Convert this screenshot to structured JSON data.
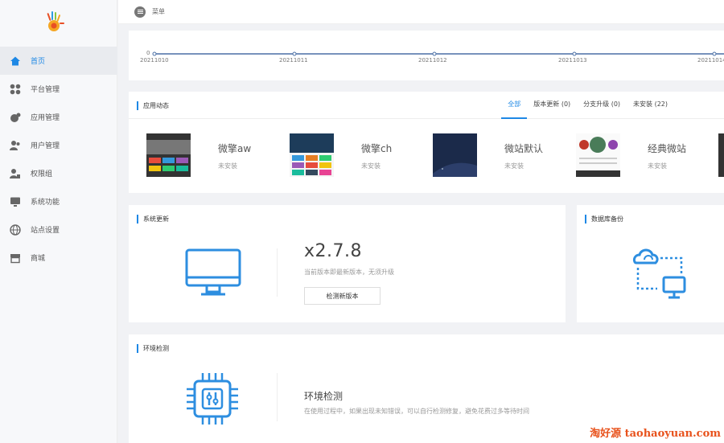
{
  "topbar": {
    "menu_label": "菜单"
  },
  "sidebar": {
    "items": [
      {
        "label": "首页",
        "icon": "home-icon",
        "active": true
      },
      {
        "label": "平台管理",
        "icon": "grid-icon"
      },
      {
        "label": "应用管理",
        "icon": "apps-icon"
      },
      {
        "label": "用户管理",
        "icon": "users-icon"
      },
      {
        "label": "权限组",
        "icon": "permission-icon"
      },
      {
        "label": "系统功能",
        "icon": "monitor-icon"
      },
      {
        "label": "站点设置",
        "icon": "globe-icon"
      },
      {
        "label": "商城",
        "icon": "store-icon"
      }
    ]
  },
  "timeline": {
    "zero": "0",
    "dates": [
      "20211010",
      "20211011",
      "20211012",
      "20211013",
      "20211014"
    ]
  },
  "apps": {
    "title": "应用动态",
    "tabs": [
      {
        "label": "全部",
        "active": true
      },
      {
        "label": "版本更新 (0)"
      },
      {
        "label": "分支升级 (0)"
      },
      {
        "label": "未安装 (22)"
      }
    ],
    "list": [
      {
        "name": "微擎aw",
        "status": "未安装"
      },
      {
        "name": "微擎ch",
        "status": "未安装"
      },
      {
        "name": "微站默认",
        "status": "未安装"
      },
      {
        "name": "经典微站",
        "status": "未安装"
      }
    ]
  },
  "update": {
    "title": "系统更新",
    "version": "x2.7.8",
    "desc": "当前版本即最新版本，无须升级",
    "button": "检测新版本"
  },
  "backup": {
    "title": "数据库备份"
  },
  "env": {
    "title": "环境检测",
    "heading": "环境检测",
    "desc": "在使用过程中，如果出现未知错误，可以自行检测修复，避免花费过多等待时间"
  },
  "watermark": "淘好源 taohaoyuan.com",
  "colors": {
    "accent": "#1e88e5",
    "watermark": "#e8521c"
  }
}
